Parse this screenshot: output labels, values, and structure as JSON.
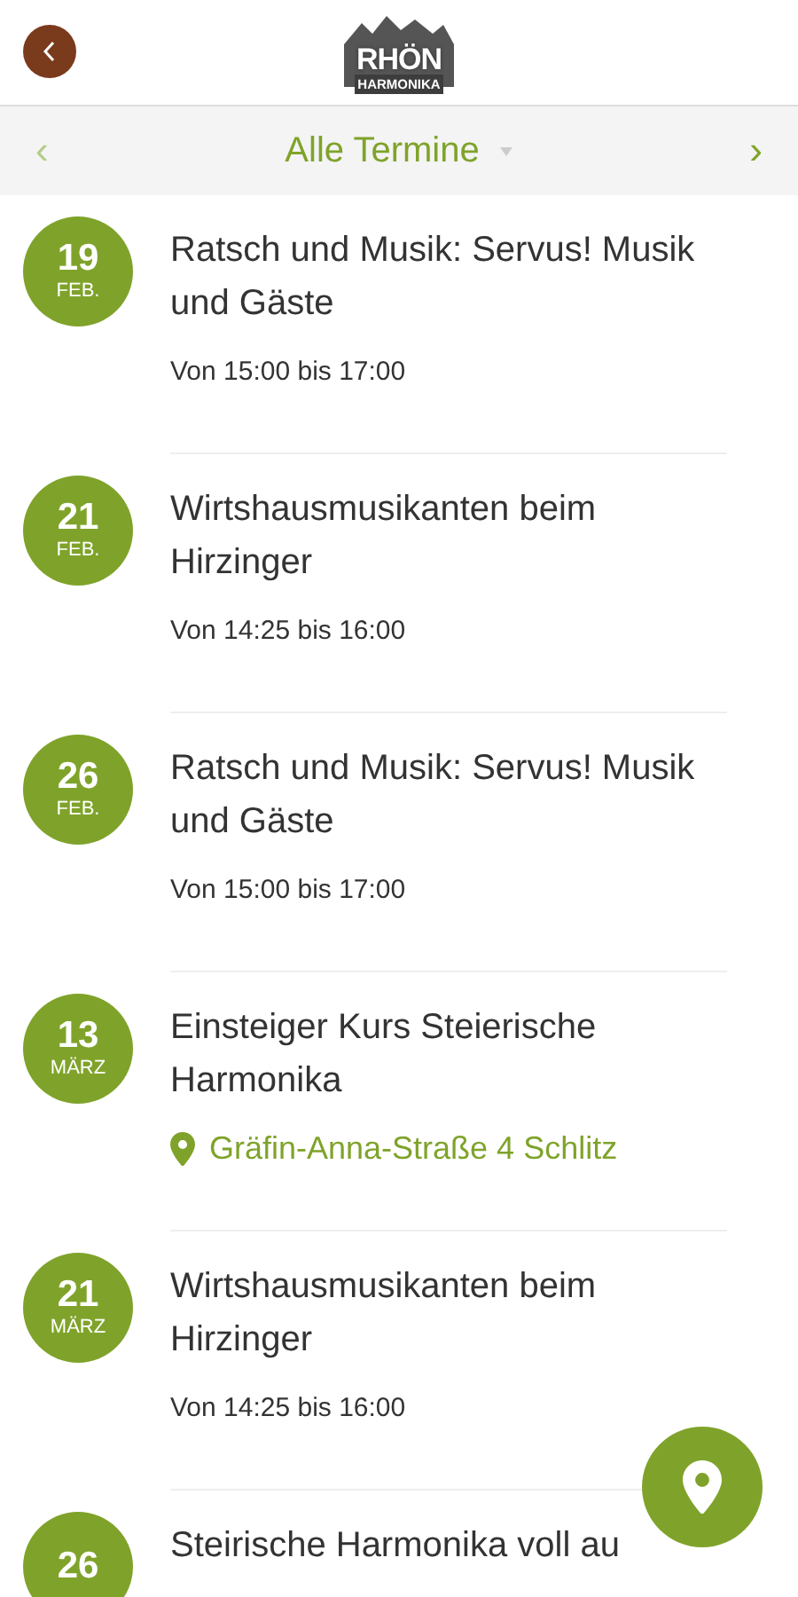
{
  "header": {
    "logo_top": "RHÖN",
    "logo_bottom": "HARMONIKA"
  },
  "nav": {
    "title": "Alle Termine",
    "prev": "‹",
    "next": "›"
  },
  "events": [
    {
      "day": "19",
      "month": "FEB.",
      "title": "Ratsch und Musik: Servus! Musik und Gäste",
      "kind": "time",
      "detail": "Von  15:00 bis 17:00"
    },
    {
      "day": "21",
      "month": "FEB.",
      "title": "Wirtshausmusikanten beim Hirzinger",
      "kind": "time",
      "detail": "Von  14:25 bis 16:00"
    },
    {
      "day": "26",
      "month": "FEB.",
      "title": "Ratsch und Musik: Servus! Musik und Gäste",
      "kind": "time",
      "detail": "Von  15:00 bis 17:00"
    },
    {
      "day": "13",
      "month": "MÄRZ",
      "title": "Einsteiger Kurs Steierische Harmonika",
      "kind": "location",
      "detail": "Gräfin-Anna-Straße 4 Schlitz"
    },
    {
      "day": "21",
      "month": "MÄRZ",
      "title": "Wirtshausmusikanten beim Hirzinger",
      "kind": "time",
      "detail": "Von  14:25 bis 16:00"
    },
    {
      "day": "26",
      "title": "Steirische Harmonika voll au"
    }
  ]
}
